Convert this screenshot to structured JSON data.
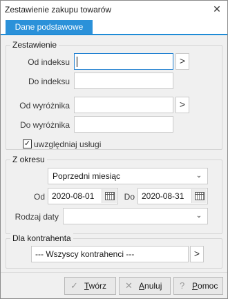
{
  "window": {
    "title": "Zestawienie zakupu towarów",
    "close_glyph": "✕"
  },
  "tabs": [
    {
      "label": "Dane podstawowe",
      "active": true
    }
  ],
  "zestawienie": {
    "legend": "Zestawienie",
    "od_indeksu_label": "Od indeksu",
    "od_indeksu_value": "",
    "do_indeksu_label": "Do indeksu",
    "do_indeksu_value": "",
    "od_wyroznika_label": "Od wyróżnika",
    "od_wyroznika_value": "",
    "do_wyroznika_label": "Do wyróżnika",
    "do_wyroznika_value": "",
    "browse_glyph": ">",
    "uwzgledniaj_uslugi_label": "uwzględniaj usługi",
    "uwzgledniaj_uslugi_checked": true,
    "check_glyph": "✓"
  },
  "z_okresu": {
    "legend": "Z okresu",
    "period_value": "Poprzedni miesiąc",
    "od_label": "Od",
    "od_value": "2020-08-01",
    "do_label": "Do",
    "do_value": "2020-08-31",
    "rodzaj_daty_label": "Rodzaj daty",
    "rodzaj_daty_value": "",
    "dropdown_glyph": "⌄"
  },
  "dla_kontrahenta": {
    "legend": "Dla kontrahenta",
    "value": "--- Wszyscy kontrahenci ---",
    "browse_glyph": ">"
  },
  "buttons": {
    "create": {
      "label_prefix": "",
      "mnemonic": "T",
      "label_rest": "wórz",
      "icon": "✓"
    },
    "cancel": {
      "label_prefix": "",
      "mnemonic": "A",
      "label_rest": "nuluj",
      "icon": "✕"
    },
    "help": {
      "label_prefix": "",
      "mnemonic": "P",
      "label_rest": "omoc",
      "icon": "?"
    }
  },
  "colors": {
    "accent": "#2b91d9",
    "focus_border": "#1e7fd1"
  }
}
